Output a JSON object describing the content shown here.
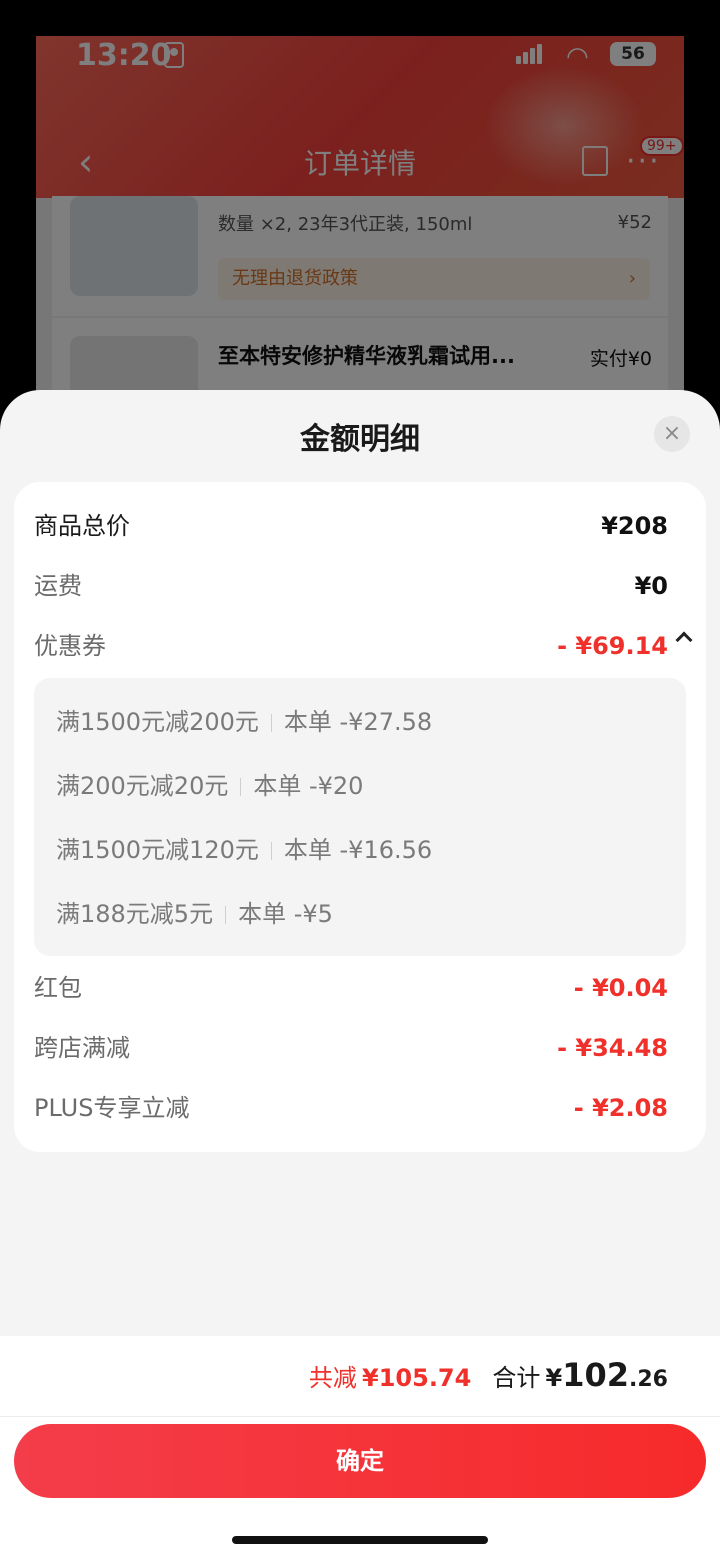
{
  "status_bar": {
    "time": "13:20",
    "battery": "56"
  },
  "background_page": {
    "nav_title": "订单详情",
    "badge": "99+",
    "item1_qty": "数量 ×2, 23年3代正装, 150ml",
    "item1_price": "¥52",
    "policy": "无理由退货政策",
    "item2_name": "至本特安修护精华液乳霜试用...",
    "item2_paid": "实付¥0"
  },
  "sheet": {
    "title": "金额明细",
    "rows": [
      {
        "label": "商品总价",
        "value": "¥208"
      },
      {
        "label": "运费",
        "value": "¥0"
      },
      {
        "label": "优惠券",
        "value": "- ¥69.14"
      }
    ],
    "coupons": [
      {
        "rule": "满1500元减200元",
        "amount": "本单 -¥27.58"
      },
      {
        "rule": "满200元减20元",
        "amount": "本单 -¥20"
      },
      {
        "rule": "满1500元减120元",
        "amount": "本单 -¥16.56"
      },
      {
        "rule": "满188元减5元",
        "amount": "本单 -¥5"
      }
    ],
    "rows_after": [
      {
        "label": "红包",
        "value": "- ¥0.04"
      },
      {
        "label": "跨店满减",
        "value": "- ¥34.48"
      },
      {
        "label": "PLUS专享立减",
        "value": "- ¥2.08"
      }
    ]
  },
  "footer": {
    "saved_label": "共减",
    "saved_value": "¥105.74",
    "sum_label": "合计",
    "sum_symbol": "¥",
    "sum_int": "102",
    "sum_dec": ".26",
    "confirm": "确定"
  },
  "colors": {
    "accent_red": "#f0302a"
  }
}
